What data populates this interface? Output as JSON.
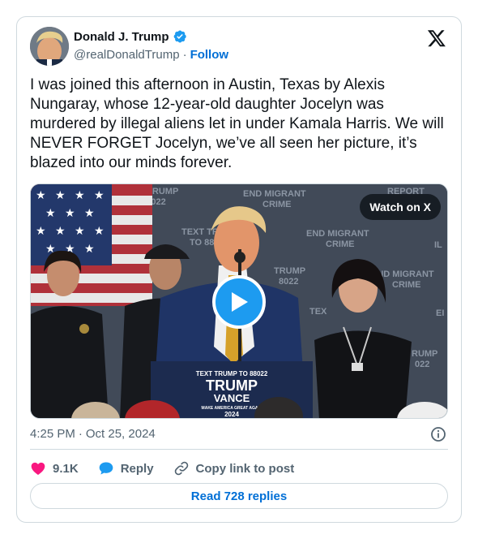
{
  "author": {
    "name": "Donald J. Trump",
    "handle": "@realDonaldTrump",
    "separator": "·",
    "follow_label": "Follow"
  },
  "tweet": {
    "text": "I was joined this afternoon in Austin, Texas by Alexis Nungaray, whose 12-year-old daughter Jocelyn was murdered by illegal aliens let in under Kamala Harris. We will NEVER FORGET Jocelyn, we’ve all seen her picture, it’s blazed into our minds forever."
  },
  "media": {
    "watch_label": "Watch on X",
    "backdrop_text": [
      "TEXT TRUMP",
      "TO 88022",
      "END MIGRANT",
      "CRIME",
      "TEXT TR",
      "TO 88",
      "END MIGRANT",
      "CRIME",
      "TRUMP",
      "8022",
      "END MIGRANT",
      "CRIME",
      "TEX",
      "RUMP",
      "022",
      "REPORT",
      "IL",
      "EI"
    ],
    "podium_sign": [
      "TEXT TRUMP TO 88022",
      "TRUMP",
      "VANCE",
      "MAKE AMERICA GREAT AGAIN",
      "2024"
    ]
  },
  "meta": {
    "time": "4:25 PM",
    "separator": "·",
    "date": "Oct 25, 2024"
  },
  "actions": {
    "likes": "9.1K",
    "reply_label": "Reply",
    "copy_label": "Copy link to post"
  },
  "replies_button": "Read 728 replies",
  "colors": {
    "link_blue": "#006fd6",
    "like_pink": "#f91880",
    "verified_blue": "#1d9bf0",
    "border": "#cfd9de",
    "secondary_text": "#536471"
  },
  "icons": [
    "verified-badge-icon",
    "x-logo-icon",
    "play-icon",
    "info-icon",
    "heart-icon",
    "reply-bubble-icon",
    "link-icon"
  ]
}
